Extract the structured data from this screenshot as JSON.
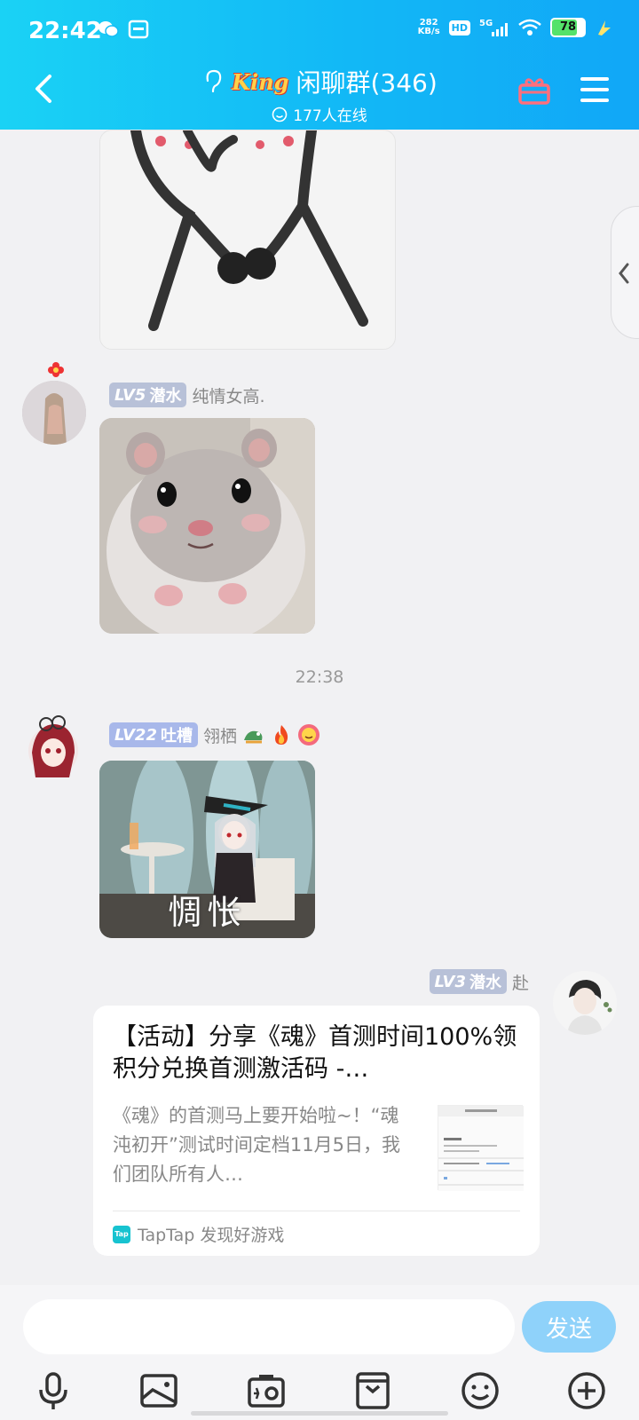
{
  "status_bar": {
    "time": "22:42",
    "net_speed_value": "282",
    "net_speed_unit": "KB/s",
    "hd": "HD",
    "network": "5G",
    "battery": "78"
  },
  "header": {
    "logo_text": "King",
    "group_name": "闲聊群(346)",
    "online_text": "177人在线"
  },
  "messages": {
    "msg1": {
      "level": "LV5",
      "role": "潜水",
      "name": "纯情女高."
    },
    "time_divider": "22:38",
    "msg2": {
      "level": "LV22",
      "role": "吐槽",
      "name": "翎栖",
      "sticker_caption": "惆怅"
    },
    "msg3": {
      "level": "LV3",
      "role": "潜水",
      "name": "赴",
      "card": {
        "title": "【活动】分享《魂》首测时间100%领积分兑换首测激活码 -…",
        "description": "《魂》的首测马上要开始啦~！“魂沌初开”测试时间定档11月5日，我们团队所有人…",
        "source_icon": "Tap",
        "source": "TapTap 发现好游戏"
      }
    }
  },
  "input_bar": {
    "placeholder": "",
    "send_label": "发送"
  },
  "colors": {
    "header_start": "#1ad2f5",
    "header_end": "#11a7f7",
    "send_button": "#8fd2fa",
    "level_badge": "#b8c1d8"
  },
  "toolbar_icons": [
    "microphone-icon",
    "photo-icon",
    "camera-icon",
    "file-icon",
    "emoji-icon",
    "plus-icon"
  ]
}
